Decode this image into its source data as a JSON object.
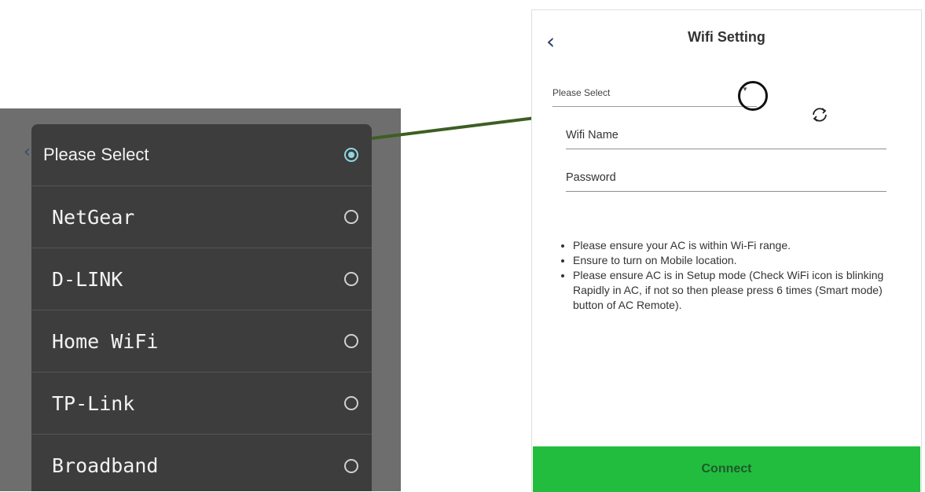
{
  "dropdown": {
    "items": [
      {
        "label": "Please Select",
        "selected": true
      },
      {
        "label": "NetGear",
        "selected": false
      },
      {
        "label": "D-LINK",
        "selected": false
      },
      {
        "label": "Home WiFi",
        "selected": false
      },
      {
        "label": "TP-Link",
        "selected": false
      },
      {
        "label": "Broadband",
        "selected": false
      }
    ]
  },
  "screen": {
    "back_icon": "chevron-left-icon",
    "title": "Wifi Setting",
    "select": {
      "value": "Please Select",
      "icon": "dropdown-arrow-icon"
    },
    "refresh_icon": "refresh-icon",
    "wifi_name_placeholder": "Wifi Name",
    "password_placeholder": "Password",
    "notes": [
      "Please ensure your AC is within Wi-Fi range.",
      "Ensure to turn on Mobile location.",
      "Please ensure AC is in Setup mode (Check WiFi icon is blinking Rapidly in AC, if not so then please press 6 times (Smart mode) button of AC Remote)."
    ],
    "connect_label": "Connect"
  },
  "colors": {
    "connect_button": "#22bd3e",
    "connector_line": "#3e5e22",
    "radio_selected": "#8fd8e0",
    "dropdown_bg": "#3d3d3d"
  }
}
